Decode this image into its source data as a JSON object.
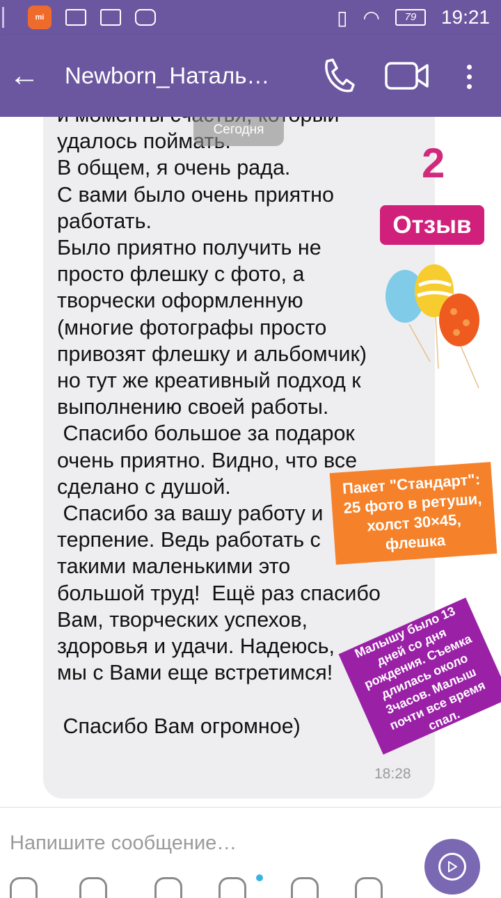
{
  "status_bar": {
    "battery": "79",
    "time": "19:21",
    "app_badge": "mi"
  },
  "header": {
    "back_label": "←",
    "title": "Newborn_Наталь…"
  },
  "chat": {
    "date_chip": "Сегодня",
    "message_text": "и моменты счастья, который\nудалось поймать.\nВ общем, я очень рада.\nС вами было очень приятно\nработать.\nБыло приятно получить не\nпросто флешку с фото, а\nтворчески оформленную\n(многие фотографы просто\nпривозят флешку и альбомчик)\nно тут же креативный подход к\nвыполнению своей работы.\n Спасибо большое за подарок\nочень приятно. Видно, что все\nсделано с душой.\n Спасибо за вашу работу и\nтерпение. Ведь работать с\nтакими маленькими это\nбольшой труд!  Ещё раз спасибо\nВам, творческих успехов,\nздоровья и удачи. Надеюсь,\nмы с Вами еще встретимся!\n\n Спасибо Вам огромное)",
    "time": "18:28"
  },
  "overlays": {
    "number": "2",
    "badge": "Отзыв",
    "orange_note": "Пакет \"Стандарт\": 25 фото в ретуши, холст 30×45, флешка",
    "purple_note": "Малышу было 13 дней со дня рождения. Съемка длилась около 3часов. Малыш почти все время спал."
  },
  "composer": {
    "placeholder": "Напишите сообщение…"
  },
  "colors": {
    "header": "#6b579f",
    "badge": "#d11f7c",
    "orange": "#f5822a",
    "purple": "#9a20a6",
    "send": "#7a68b3"
  }
}
